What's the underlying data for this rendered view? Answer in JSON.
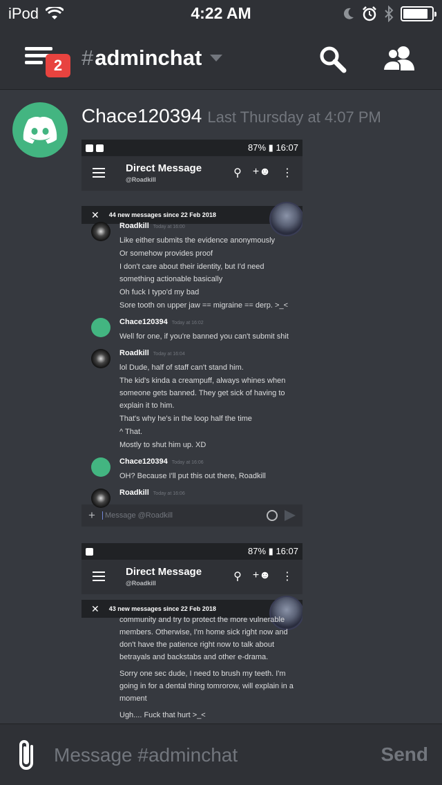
{
  "status_bar": {
    "carrier": "iPod",
    "time": "4:22 AM",
    "battery_level": 0.88
  },
  "header": {
    "menu_badge": "2",
    "channel_hash": "#",
    "channel_name": "adminchat",
    "icons": [
      "hamburger-menu-icon",
      "search-icon",
      "members-icon"
    ]
  },
  "message": {
    "author": "Chace120394",
    "timestamp": "Last Thursday at 4:07 PM",
    "attachment_1": {
      "phone_status": "87%",
      "phone_time": "16:07",
      "dm_title": "Direct Message",
      "dm_subtitle": "@Roadkill",
      "new_messages": "44 new messages since 22 Feb 2018",
      "messages": [
        {
          "author": "Roadkill",
          "time": "Today at 16:00",
          "avatar": "rk",
          "lines": [
            "Like either submits the evidence anonymously",
            "Or somehow provides proof",
            "I don't care about their identity, but I'd need something actionable basically",
            "Oh fuck I typo'd my bad",
            "Sore tooth on upper jaw == migraine == derp. >_<"
          ]
        },
        {
          "author": "Chace120394",
          "time": "Today at 16:02",
          "avatar": "ch",
          "lines": [
            "Well for one, if you're banned you can't submit shit"
          ]
        },
        {
          "author": "Roadkill",
          "time": "Today at 16:04",
          "avatar": "rk",
          "lines": [
            "lol Dude, half of staff can't stand him.",
            "The kid's kinda a creampuff, always whines when someone gets banned. They get sick of having to explain it to him.",
            "That's why he's in the loop half the time",
            "^ That.",
            "Mostly to shut him up. XD"
          ]
        },
        {
          "author": "Chace120394",
          "time": "Today at 16:06",
          "avatar": "ch",
          "lines": [
            "OH? Because I'll put this out there, Roadkill"
          ]
        },
        {
          "author": "Roadkill",
          "time": "Today at 16:06",
          "avatar": "rk",
          "lines": []
        }
      ],
      "input_placeholder": "Message @Roadkill"
    },
    "attachment_2": {
      "phone_status": "87%",
      "phone_time": "16:07",
      "dm_title": "Direct Message",
      "dm_subtitle": "@Roadkill",
      "new_messages": "43 new messages since 22 Feb 2018",
      "lines": [
        "community and try to protect the more vulnerable members. Otherwise, I'm home sick right now and don't have the patience right now to talk about betrayals and backstabs and other e-drama.",
        "Sorry one sec dude, I need to brush my teeth. I'm going in for a dental thing tomrorow, will explain in a moment",
        "Ugh.... Fuck that hurt >_<"
      ]
    }
  },
  "composer": {
    "placeholder": "Message #adminchat",
    "send_label": "Send"
  },
  "colors": {
    "background": "#36393f",
    "header": "#2f3136",
    "badge": "#e8433f",
    "avatar_green": "#43b581",
    "muted_text": "#72767d"
  }
}
